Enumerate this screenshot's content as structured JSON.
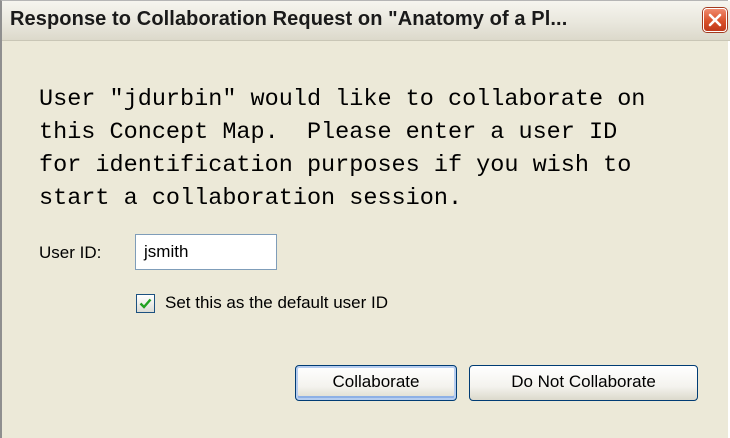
{
  "dialog": {
    "title": "Response to Collaboration Request on \"Anatomy of a Pl...",
    "close_icon": "close-icon",
    "message_lines": [
      "User \"jdurbin\" would like to collaborate on",
      "this Concept Map.  Please enter a user ID",
      "for identification purposes if you wish to",
      "start a collaboration session."
    ],
    "user_id_label": "User ID:",
    "user_id_value": "jsmith",
    "default_checkbox": {
      "checked": true,
      "label": "Set this as the default user ID"
    },
    "buttons": {
      "collaborate": "Collaborate",
      "do_not_collaborate": "Do Not Collaborate"
    }
  }
}
